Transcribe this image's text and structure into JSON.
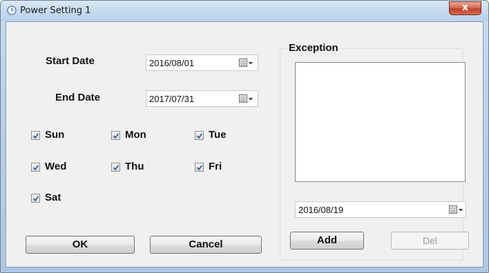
{
  "window": {
    "title": "Power Setting 1",
    "close_label": "x"
  },
  "dates": {
    "start_label": "Start Date",
    "start_value": "2016/08/01",
    "end_label": "End Date",
    "end_value": "2017/07/31"
  },
  "days": [
    {
      "label": "Sun",
      "checked": true
    },
    {
      "label": "Mon",
      "checked": true
    },
    {
      "label": "Tue",
      "checked": true
    },
    {
      "label": "Wed",
      "checked": true
    },
    {
      "label": "Thu",
      "checked": true
    },
    {
      "label": "Fri",
      "checked": true
    },
    {
      "label": "Sat",
      "checked": true
    }
  ],
  "buttons": {
    "ok": "OK",
    "cancel": "Cancel"
  },
  "exception": {
    "title": "Exception",
    "items": [],
    "date_value": "2016/08/19",
    "add_label": "Add",
    "del_label": "Del"
  },
  "colors": {
    "check": "#2b62a8",
    "title_bar": "#c6dbef",
    "close": "#c0402a"
  }
}
